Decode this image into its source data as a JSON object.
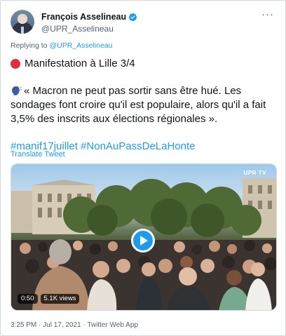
{
  "author": {
    "display_name": "François Asselineau",
    "handle": "@UPR_Asselineau",
    "verified": true
  },
  "reply_context": {
    "prefix": "Replying to",
    "mention": "@UPR_Asselineau"
  },
  "tweet": {
    "line1": "Manifestation à Lille 3/4",
    "body": "« Macron ne peut pas sortir sans être hué. Les sondages font croire qu'il est populaire, alors qu'il a fait 3,5% des inscrits aux élections régionales ».",
    "hashtags": "#manif17juillet #NonAuPassDeLaHonte",
    "translate_label": "Translate Tweet"
  },
  "media": {
    "watermark": "UPR TV",
    "duration": "0:50",
    "views": "5.1K views"
  },
  "meta": {
    "timestamp": "3:25 PM · Jul 17, 2021 · Twitter Web App"
  },
  "icons": {
    "verified": "verified-badge-icon",
    "more": "more-dots-icon",
    "red_circle": "red-circle-emoji",
    "speaker": "speaking-head-emoji",
    "play": "play-icon"
  },
  "colors": {
    "accent": "#1d9bf0",
    "text": "#0f1419",
    "secondary": "#536471",
    "border": "#cfd9de",
    "red": "#dd2e44"
  }
}
